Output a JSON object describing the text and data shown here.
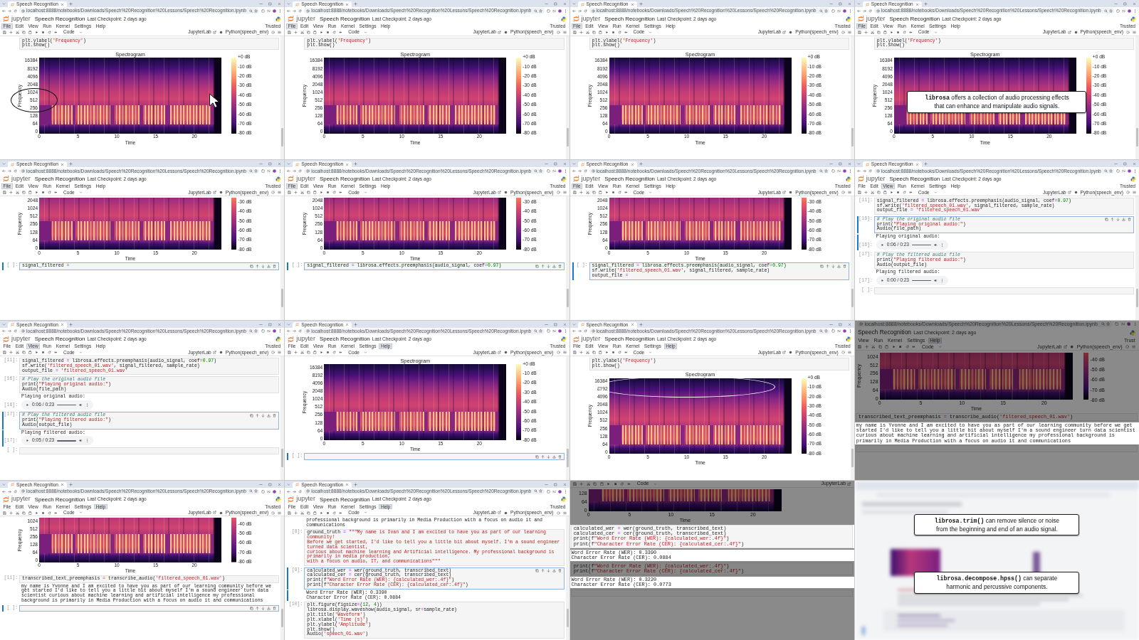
{
  "tiles": [
    {
      "kind": "notebook",
      "tab": "Speech Recognition",
      "url": "localhost:8888/notebooks/Downloads/Speech%20Recognition%20Lessons/Speech%20Recognition.ipynb",
      "logo": "jupyter",
      "title": "Speech Recognition",
      "checkpoint": "Last Checkpoint: 2 days ago",
      "menu": [
        {
          "label": "File",
          "selected": true
        },
        {
          "label": "Edit",
          "selected": false
        },
        {
          "label": "View",
          "selected": false
        },
        {
          "label": "Run",
          "selected": false
        },
        {
          "label": "Kernel",
          "selected": false
        },
        {
          "label": "Settings",
          "selected": false
        },
        {
          "label": "Help",
          "selected": false
        }
      ],
      "trusted": "Trusted",
      "cell_type": "Code",
      "lab_link": "JupyterLab",
      "kernel": "Python(speech_env)",
      "blocks": [
        {
          "kind": "code",
          "selected": false,
          "lines": [
            "plt.ylabel('Frequency')",
            "plt.show()"
          ]
        },
        {
          "kind": "spectrogram",
          "title": "Spectrogram",
          "y_label": "Frequency",
          "y_ticks": [
            "16384",
            "8192",
            "4096",
            "2048",
            "1024",
            "512",
            "256",
            "128",
            "64",
            "0"
          ],
          "x_ticks": [
            "0",
            "5",
            "10",
            "15",
            "20"
          ],
          "x_label": "Time",
          "colorbar_ticks": [
            "+0 dB",
            "-10 dB",
            "-20 dB",
            "-30 dB",
            "-40 dB",
            "-50 dB",
            "-60 dB",
            "-70 dB",
            "-80 dB"
          ],
          "axis_circled": true,
          "pointer": true
        }
      ]
    },
    {
      "kind": "notebook",
      "tab": "Speech Recognition",
      "url": "localhost:8888/notebooks/Downloads/Speech%20Recognition%20Lessons/Speech%20Recognition.ipynb",
      "logo": "jupyter",
      "title": "Speech Recognition",
      "checkpoint": "Last Checkpoint: 2 days ago",
      "menu": [
        {
          "label": "File",
          "selected": true
        },
        {
          "label": "Edit",
          "selected": false
        },
        {
          "label": "View",
          "selected": false
        },
        {
          "label": "Run",
          "selected": false
        },
        {
          "label": "Kernel",
          "selected": false
        },
        {
          "label": "Settings",
          "selected": false
        },
        {
          "label": "Help",
          "selected": false
        }
      ],
      "trusted": "Trusted",
      "cell_type": "Code",
      "lab_link": "JupyterLab",
      "kernel": "Python(speech_env)",
      "blocks": [
        {
          "kind": "code",
          "selected": false,
          "lines": [
            "plt.ylabel('Frequency')",
            "plt.show()"
          ]
        },
        {
          "kind": "spectrogram",
          "title": "Spectrogram",
          "y_label": "Frequency",
          "y_ticks": [
            "16384",
            "8192",
            "4096",
            "2048",
            "1024",
            "512",
            "256",
            "128",
            "64",
            "0"
          ],
          "x_ticks": [
            "0",
            "5",
            "10",
            "15",
            "20"
          ],
          "x_label": "Time",
          "colorbar_ticks": [
            "+0 dB",
            "-10 dB",
            "-20 dB",
            "-30 dB",
            "-40 dB",
            "-50 dB",
            "-60 dB",
            "-70 dB",
            "-80 dB"
          ]
        }
      ]
    },
    {
      "kind": "notebook",
      "tab": "Speech Recognition",
      "url": "localhost:8888/notebooks/Downloads/Speech%20Recognition%20Lessons/Speech%20Recognition.ipynb",
      "logo": "jupyter",
      "title": "Speech Recognition",
      "checkpoint": "Last Checkpoint: 2 days ago",
      "menu": [
        {
          "label": "File",
          "selected": true
        },
        {
          "label": "Edit",
          "selected": false
        },
        {
          "label": "View",
          "selected": false
        },
        {
          "label": "Run",
          "selected": false
        },
        {
          "label": "Kernel",
          "selected": false
        },
        {
          "label": "Settings",
          "selected": false
        },
        {
          "label": "Help",
          "selected": false
        }
      ],
      "trusted": "Trusted",
      "cell_type": "Code",
      "lab_link": "JupyterLab",
      "kernel": "Python(speech_env)",
      "blocks": [
        {
          "kind": "code",
          "selected": false,
          "lines": [
            "plt.ylabel('Frequency')",
            "plt.show()"
          ]
        },
        {
          "kind": "spectrogram",
          "title": "Spectrogram",
          "y_label": "Frequency",
          "y_ticks": [
            "16384",
            "8192",
            "4096",
            "2048",
            "1024",
            "512",
            "256",
            "128",
            "64",
            "0"
          ],
          "x_ticks": [
            "0",
            "5",
            "10",
            "15",
            "20"
          ],
          "x_label": "Time",
          "colorbar_ticks": [
            "+0 dB",
            "-10 dB",
            "-20 dB",
            "-30 dB",
            "-40 dB",
            "-50 dB",
            "-60 dB",
            "-70 dB",
            "-80 dB"
          ]
        }
      ]
    },
    {
      "kind": "notebook",
      "tab": "Speech Recognition",
      "url": "localhost:8888/notebooks/Downloads/Speech%20Recognition%20Lessons/Speech%20Recognition.ipynb",
      "logo": "jupyter",
      "title": "Speech Recognition",
      "checkpoint": "Last Checkpoint: 2 days ago",
      "menu": [
        {
          "label": "File",
          "selected": true
        },
        {
          "label": "Edit",
          "selected": false
        },
        {
          "label": "View",
          "selected": false
        },
        {
          "label": "Run",
          "selected": false
        },
        {
          "label": "Kernel",
          "selected": false
        },
        {
          "label": "Settings",
          "selected": false
        },
        {
          "label": "Help",
          "selected": false
        }
      ],
      "trusted": "Trusted",
      "cell_type": "Code",
      "lab_link": "JupyterLab",
      "kernel": "Python(speech_env)",
      "blocks": [
        {
          "kind": "code",
          "selected": false,
          "lines": [
            "plt.ylabel('Frequency')",
            "plt.show()"
          ]
        },
        {
          "kind": "spectrogram",
          "title": "Spectrogram",
          "y_label": "Frequency",
          "y_ticks": [
            "16384",
            "8192",
            "4096",
            "2048",
            "1024",
            "512",
            "256",
            "128",
            "64",
            "0"
          ],
          "x_ticks": [
            "0",
            "5",
            "10",
            "15",
            "20"
          ],
          "x_label": "Time",
          "colorbar_ticks": [
            "+0 dB",
            "-10 dB",
            "-20 dB",
            "-30 dB",
            "-40 dB",
            "-50 dB",
            "-60 dB",
            "-70 dB",
            "-80 dB"
          ]
        }
      ],
      "callouts": [
        "**librosa** offers a collection of audio processing effects that can enhance and manipulate audio signals."
      ]
    },
    {
      "kind": "notebook",
      "tab": "Speech Recognition",
      "url": "localhost:8888/notebooks/Downloads/Speech%20Recognition%20Lessons/Speech%20Recognition.ipynb",
      "logo": "jupyter",
      "title": "Speech Recognition",
      "checkpoint": "Last Checkpoint: 2 days ago",
      "menu": [
        {
          "label": "File",
          "selected": true
        },
        {
          "label": "Edit",
          "selected": false
        },
        {
          "label": "View",
          "selected": false
        },
        {
          "label": "Run",
          "selected": false
        },
        {
          "label": "Kernel",
          "selected": false
        },
        {
          "label": "Settings",
          "selected": false
        },
        {
          "label": "Help",
          "selected": false
        }
      ],
      "trusted": "Trusted",
      "cell_type": "Code",
      "lab_link": "JupyterLab",
      "kernel": "Python(speech_env)",
      "blocks": [
        {
          "kind": "spectrogram",
          "y_label": "Frequency",
          "y_ticks": [
            "2048",
            "1024",
            "512",
            "256",
            "128",
            "64",
            "0"
          ],
          "x_ticks": [
            "0",
            "5",
            "10",
            "15",
            "20"
          ],
          "x_label": "Time",
          "colorbar_ticks": [
            "-30 dB",
            "-40 dB",
            "-50 dB",
            "-60 dB",
            "-70 dB",
            "-80 dB"
          ]
        },
        {
          "kind": "code",
          "prompt": "[ ]:",
          "selected": true,
          "lines": [
            "signal_filtered = "
          ]
        }
      ]
    },
    {
      "kind": "notebook",
      "tab": "Speech Recognition",
      "url": "localhost:8888/notebooks/Downloads/Speech%20Recognition%20Lessons/Speech%20Recognition.ipynb",
      "logo": "jupyter",
      "title": "Speech Recognition",
      "checkpoint": "Last Checkpoint: 2 days ago",
      "menu": [
        {
          "label": "File",
          "selected": true
        },
        {
          "label": "Edit",
          "selected": false
        },
        {
          "label": "View",
          "selected": false
        },
        {
          "label": "Run",
          "selected": false
        },
        {
          "label": "Kernel",
          "selected": false
        },
        {
          "label": "Settings",
          "selected": false
        },
        {
          "label": "Help",
          "selected": false
        }
      ],
      "trusted": "Trusted",
      "cell_type": "Code",
      "lab_link": "JupyterLab",
      "kernel": "Python(speech_env)",
      "blocks": [
        {
          "kind": "spectrogram",
          "y_label": "Frequency",
          "y_ticks": [
            "2048",
            "1024",
            "512",
            "256",
            "128",
            "64",
            "0"
          ],
          "x_ticks": [
            "0",
            "5",
            "10",
            "15",
            "20"
          ],
          "x_label": "Time",
          "colorbar_ticks": [
            "-30 dB",
            "-40 dB",
            "-50 dB",
            "-60 dB",
            "-70 dB",
            "-80 dB"
          ]
        },
        {
          "kind": "code",
          "prompt": "[ ]:",
          "selected": true,
          "lines": [
            "signal_filtered = librosa.effects.preemphasis(audio_signal, coef=0.97)"
          ]
        }
      ]
    },
    {
      "kind": "notebook",
      "tab": "Speech Recognition",
      "url": "localhost:8888/notebooks/Downloads/Speech%20Recognition%20Lessons/Speech%20Recognition.ipynb",
      "logo": "jupyter",
      "title": "Speech Recognition",
      "checkpoint": "Last Checkpoint: 2 days ago",
      "menu": [
        {
          "label": "File",
          "selected": true
        },
        {
          "label": "Edit",
          "selected": false
        },
        {
          "label": "View",
          "selected": false
        },
        {
          "label": "Run",
          "selected": false
        },
        {
          "label": "Kernel",
          "selected": false
        },
        {
          "label": "Settings",
          "selected": false
        },
        {
          "label": "Help",
          "selected": false
        }
      ],
      "trusted": "Trusted",
      "cell_type": "Code",
      "lab_link": "JupyterLab",
      "kernel": "Python(speech_env)",
      "blocks": [
        {
          "kind": "spectrogram",
          "y_label": "Frequency",
          "y_ticks": [
            "2048",
            "1024",
            "512",
            "256",
            "128",
            "64",
            "0"
          ],
          "x_ticks": [
            "0",
            "5",
            "10",
            "15",
            "20"
          ],
          "x_label": "Time",
          "colorbar_ticks": [
            "-30 dB",
            "-40 dB",
            "-50 dB",
            "-60 dB",
            "-70 dB",
            "-80 dB"
          ]
        },
        {
          "kind": "code",
          "prompt": "[ ]:",
          "selected": true,
          "lines": [
            "signal_filtered = librosa.effects.preemphasis(audio_signal, coef=0.97)",
            "sf.write('filtered_speech_01.wav', signal_filtered, sample_rate)",
            "output_file = "
          ]
        }
      ]
    },
    {
      "kind": "notebook",
      "tab": "Speech Recognition",
      "url": "localhost:8888/notebooks/Downloads/Speech%20Recognition%20Lessons/Speech%20Recognition.ipynb",
      "logo": "jupyter",
      "title": "Speech Recognition",
      "checkpoint": "Last Checkpoint: 2 days ago",
      "menu": [
        {
          "label": "File",
          "selected": false
        },
        {
          "label": "Edit",
          "selected": false
        },
        {
          "label": "View",
          "selected": true
        },
        {
          "label": "Run",
          "selected": false
        },
        {
          "label": "Kernel",
          "selected": false
        },
        {
          "label": "Settings",
          "selected": false
        },
        {
          "label": "Help",
          "selected": false
        }
      ],
      "trusted": "Trusted",
      "cell_type": "Code",
      "lab_link": "JupyterLab",
      "kernel": "Python(speech_env)",
      "blocks": [
        {
          "kind": "code",
          "prompt": "[11]:",
          "selected": false,
          "lines": [
            "signal_filtered = librosa.effects.preemphasis(audio_signal, coef=0.97)",
            "sf.write('filtered_speech_01.wav', signal_filtered, sample_rate)",
            "output_file = 'filtered_speech_01.wav'"
          ]
        },
        {
          "kind": "code",
          "prompt": "[16]:",
          "selected": true,
          "lines": [
            "# Play the original audio file",
            "print(\"Playing original audio:\")",
            "Audio(file_path)"
          ]
        },
        {
          "kind": "audio",
          "prompt": "[16]:",
          "selected": true,
          "label": "Playing original audio:",
          "time": "0:06 / 0:23"
        },
        {
          "kind": "code",
          "prompt": "[17]:",
          "selected": false,
          "lines": [
            "# Play the filtered audio file",
            "print(\"Playing filtered audio:\")",
            "Audio(output_file)"
          ]
        },
        {
          "kind": "audio",
          "prompt": "[17]:",
          "selected": false,
          "label": "Playing filtered audio:",
          "time": "0:00 / 0:23"
        },
        {
          "kind": "code",
          "prompt": "[ ]:",
          "selected": false
        }
      ]
    },
    {
      "kind": "notebook",
      "tab": "Speech Recognition",
      "url": "localhost:8888/notebooks/Downloads/Speech%20Recognition%20Lessons/Speech%20Recognition.ipynb",
      "logo": "jupyter",
      "title": "Speech Recognition",
      "checkpoint": "Last Checkpoint: 2 days ago",
      "menu": [
        {
          "label": "File",
          "selected": false
        },
        {
          "label": "Edit",
          "selected": false
        },
        {
          "label": "View",
          "selected": true
        },
        {
          "label": "Run",
          "selected": false
        },
        {
          "label": "Kernel",
          "selected": false
        },
        {
          "label": "Settings",
          "selected": false
        },
        {
          "label": "Help",
          "selected": false
        }
      ],
      "trusted": "Trusted",
      "cell_type": "Code",
      "lab_link": "JupyterLab",
      "kernel": "Python(speech_env)",
      "blocks": [
        {
          "kind": "code",
          "prompt": "[11]:",
          "selected": false,
          "lines": [
            "signal_filtered = librosa.effects.preemphasis(audio_signal, coef=0.97)",
            "sf.write('filtered_speech_01.wav', signal_filtered, sample_rate)",
            "output_file = 'filtered_speech_01.wav'"
          ]
        },
        {
          "kind": "code",
          "prompt": "[16]:",
          "selected": false,
          "lines": [
            "# Play the original audio file",
            "print(\"Playing original audio:\")",
            "Audio(file_path)"
          ]
        },
        {
          "kind": "audio",
          "prompt": "[16]:",
          "selected": false,
          "label": "Playing original audio:",
          "time": "0:06 / 0:23"
        },
        {
          "kind": "code",
          "prompt": "[17]:",
          "selected": true,
          "lines": [
            "# Play the filtered audio file",
            "print(\"Playing filtered audio:\")",
            "Audio(output_file)"
          ]
        },
        {
          "kind": "audio",
          "prompt": "[17]:",
          "selected": true,
          "label": "Playing filtered audio:",
          "time": "0:05 / 0:23"
        },
        {
          "kind": "code",
          "prompt": "[ ]:",
          "selected": false
        }
      ]
    },
    {
      "kind": "notebook",
      "tab": "Speech Recognition",
      "url": "localhost:8888/notebooks/Downloads/Speech%20Recognition%20Lessons/Speech%20Recognition.ipynb",
      "logo": "jupyter",
      "title": "Speech Recognition",
      "checkpoint": "Last Checkpoint: 2 days ago",
      "menu": [
        {
          "label": "File",
          "selected": false
        },
        {
          "label": "Edit",
          "selected": false
        },
        {
          "label": "View",
          "selected": false
        },
        {
          "label": "Run",
          "selected": false
        },
        {
          "label": "Kernel",
          "selected": false
        },
        {
          "label": "Settings",
          "selected": false
        },
        {
          "label": "Help",
          "selected": true
        }
      ],
      "trusted": "Trusted",
      "cell_type": "Code",
      "lab_link": "JupyterLab",
      "kernel": "Python(speech_env)",
      "blocks": [
        {
          "kind": "spectrogram",
          "title": "Spectrogram",
          "y_label": "Frequency",
          "y_ticks": [
            "16384",
            "8192",
            "4096",
            "2048",
            "1024",
            "512",
            "256",
            "128",
            "64",
            "0"
          ],
          "x_ticks": [
            "0",
            "5",
            "10",
            "15",
            "20"
          ],
          "x_label": "Time",
          "colorbar_ticks": [
            "+0 dB",
            "-10 dB",
            "-20 dB",
            "-30 dB",
            "-40 dB",
            "-50 dB",
            "-60 dB",
            "-70 dB",
            "-80 dB"
          ]
        },
        {
          "kind": "code",
          "prompt": "[ ]:",
          "selected": true
        }
      ]
    },
    {
      "kind": "notebook",
      "tab": "Speech Recognition",
      "url": "localhost:8888/notebooks/Downloads/Speech%20Recognition%20Lessons/Speech%20Recognition.ipynb",
      "logo": "jupyter",
      "title": "Speech Recognition",
      "checkpoint": "Last Checkpoint: 2 days ago",
      "menu": [
        {
          "label": "File",
          "selected": false
        },
        {
          "label": "Edit",
          "selected": false
        },
        {
          "label": "View",
          "selected": false
        },
        {
          "label": "Run",
          "selected": false
        },
        {
          "label": "Kernel",
          "selected": false
        },
        {
          "label": "Settings",
          "selected": false
        },
        {
          "label": "Help",
          "selected": true
        }
      ],
      "trusted": "Trusted",
      "cell_type": "Code",
      "lab_link": "JupyterLab",
      "kernel": "Python(speech_env)",
      "blocks": [
        {
          "kind": "code",
          "selected": false,
          "lines": [
            "plt.ylabel('Frequency')",
            "plt.show()"
          ]
        },
        {
          "kind": "spectrogram",
          "title": "Spectrogram",
          "y_label": "Frequency",
          "y_ticks": [
            "16384",
            "8192",
            "4096",
            "2048",
            "1024",
            "512",
            "256",
            "128",
            "64",
            "0"
          ],
          "x_ticks": [
            "0",
            "5",
            "10",
            "15",
            "20"
          ],
          "x_label": "Time",
          "colorbar_ticks": [
            "+0 dB",
            "-10 dB",
            "-20 dB",
            "-30 dB",
            "-40 dB",
            "-50 dB",
            "-60 dB",
            "-70 dB",
            "-80 dB"
          ],
          "band_circled": true
        }
      ]
    },
    {
      "kind": "zoomed",
      "chrome_dimmed": true,
      "url": "localhost:8888/notebooks/Downloads/Speech%20Recognition%20Lessons/Speech%20Recognition.ipynb",
      "title": "Speech Recognition",
      "checkpoint": "Last Checkpoint: 2 days ago",
      "menu": [
        {
          "label": "View",
          "selected": false
        },
        {
          "label": "Run",
          "selected": false
        },
        {
          "label": "Kernel",
          "selected": false
        },
        {
          "label": "Settings",
          "selected": false
        },
        {
          "label": "Help",
          "selected": true
        }
      ],
      "trusted": "Trust",
      "cell_type": "Code",
      "lab_link": "JupyterLab",
      "kernel": "Python(speech_env)",
      "blocks": [
        {
          "kind": "spectrogram",
          "dimmed": true,
          "y_label": "Frequency",
          "y_ticks": [
            "1024",
            "512",
            "256",
            "128",
            "64",
            "0"
          ],
          "x_ticks": [
            "0",
            "5",
            "10",
            "15",
            "20"
          ],
          "x_label": "Time",
          "colorbar_ticks": [
            "-40 dB",
            "-50 dB",
            "-60 dB",
            "-70 dB",
            "-80 dB"
          ]
        },
        {
          "kind": "code",
          "selected": false,
          "dimmed": true,
          "lines": [
            "transcribed_text_preemphasis = transcribe_audio('filtered_speech_01.wav')"
          ]
        },
        {
          "kind": "output",
          "selected": false,
          "dimmed": false,
          "lines": [
            "my name is Yvonne and I am excited to have you as part of our learning community before we get started I'd like to tell you a little bit about myself I'm a sound engineer turn data scientist curious about machine learning and artificial intelligence my professional background is primarily in Media Production with a focus on audio it and communications"
          ]
        },
        {
          "kind": "code",
          "selected": false,
          "dimmed": true
        }
      ]
    },
    {
      "kind": "notebook",
      "tab": "Speech Recognition",
      "url": "localhost:8888/notebooks/Downloads/Speech%20Recognition%20Lessons/Speech%20Recognition.ipynb",
      "logo": "jupyter",
      "title": "Speech Recognition",
      "checkpoint": "Last Checkpoint: 2 days ago",
      "menu": [
        {
          "label": "File",
          "selected": false
        },
        {
          "label": "Edit",
          "selected": false
        },
        {
          "label": "View",
          "selected": false
        },
        {
          "label": "Run",
          "selected": false
        },
        {
          "label": "Kernel",
          "selected": false
        },
        {
          "label": "Settings",
          "selected": false
        },
        {
          "label": "Help",
          "selected": true
        }
      ],
      "trusted": "Trusted",
      "cell_type": "Code",
      "lab_link": "JupyterLab",
      "kernel": "Python(speech_env)",
      "blocks": [
        {
          "kind": "spectrogram",
          "y_label": "Frequency",
          "y_ticks": [
            "1024",
            "512",
            "256",
            "128",
            "64",
            "0"
          ],
          "x_ticks": [
            "0",
            "5",
            "10",
            "15",
            "20"
          ],
          "x_label": "Time",
          "colorbar_ticks": [
            "-40 dB",
            "-50 dB",
            "-60 dB",
            "-70 dB",
            "-80 dB"
          ]
        },
        {
          "kind": "code",
          "prompt": "[11]:",
          "selected": false,
          "lines": [
            "transcribed_text_preemphasis = transcribe_audio('filtered_speech_01.wav')"
          ]
        },
        {
          "kind": "output",
          "selected": false,
          "lines": [
            "my name is Yvonne and I am excited to have you as part of our learning community before we get started I'd like to tell you a little bit about myself I'm a sound engineer turn data scientist curious about machine learning and artificial intelligence my professional background is primarily in Media Production with a focus on audio it and communications"
          ]
        },
        {
          "kind": "code",
          "prompt": "[ ]:",
          "selected": true
        }
      ]
    },
    {
      "kind": "notebook",
      "tab": "Speech Recognition",
      "url": "localhost:8888/notebooks/Downloads/Speech%20Recognition%20Lessons/Speech%20Recognition.ipynb",
      "logo": "jupyter",
      "title": "Speech Recognition",
      "checkpoint": "Last Checkpoint: 2 days ago",
      "menu": [
        {
          "label": "File",
          "selected": false
        },
        {
          "label": "Edit",
          "selected": false
        },
        {
          "label": "View",
          "selected": false
        },
        {
          "label": "Run",
          "selected": false
        },
        {
          "label": "Kernel",
          "selected": false
        },
        {
          "label": "Settings",
          "selected": false
        },
        {
          "label": "Help",
          "selected": true
        }
      ],
      "trusted": "Trusted",
      "cell_type": "Code",
      "lab_link": "JupyterLab",
      "kernel": "Python(speech_env)",
      "blocks": [
        {
          "kind": "output",
          "selected": false,
          "lines": [
            "professional background is primarily in Media Production with a focus on audio it and communications"
          ]
        },
        {
          "kind": "code",
          "prompt": "[8]:",
          "selected": false,
          "lines": [
            "ground_truth = \"\"\"My name is Ivan and I am excited to have you as part of our learning community!",
            "Before we get started, I'd like to tell you a little bit about myself. I'm a sound engineer turned data scientist,",
            "curious about machine learning and Artificial intelligence. My professional background is primarily in media production,",
            "with a focus on audio, IT, and communications\"\"\""
          ]
        },
        {
          "kind": "code",
          "prompt": "[9]:",
          "selected": true,
          "lines": [
            "calculated_wer = wer(ground_truth, transcribed_text)",
            "calculated_cer = cer(ground_truth, transcribed_text)",
            "print(f\"Word Error Rate (WER): {calculated_wer:.4f}\")",
            "print(f\"Character Error Rate (CER): {calculated_cer:.4f}\")"
          ]
        },
        {
          "kind": "output",
          "selected": true,
          "lines": [
            "Word Error Rate (WER): 0.3390",
            "Character Error Rate (CER): 0.0884"
          ]
        },
        {
          "kind": "code",
          "prompt": "[10]:",
          "selected": false,
          "lines": [
            "plt.figure(figsize=(12, 4))",
            "librosa.display.waveshow(audio_signal, sr=sample_rate)",
            "plt.title('Waveform')",
            "plt.xlabel('Time (s)')",
            "plt.ylabel('Amplitude')",
            "plt.show()",
            "Audio('speech_01.wav')"
          ]
        }
      ]
    },
    {
      "kind": "zoomed",
      "chrome_dimmed": true,
      "cell_type": "Code",
      "lab_link": "JupyterLab",
      "blocks": [
        {
          "kind": "spectrogram",
          "dimmed": true,
          "y_ticks": [
            "128",
            "64",
            "0"
          ],
          "x_ticks": [
            "0",
            "5",
            "10",
            "15",
            "20"
          ],
          "x_label": "Time"
        },
        {
          "kind": "code",
          "selected": false,
          "dimmed": false,
          "lines": [
            "calculated_wer = wer(ground_truth, transcribed_text)",
            "calculated_cer = cer(ground_truth, transcribed_text)",
            "print(f\"Word Error Rate (WER): {calculated_wer:.4f}\")",
            "print(f\"Character Error Rate (CER): {calculated_cer:.4f}\")"
          ]
        },
        {
          "kind": "output",
          "selected": false,
          "dimmed": false,
          "lines": [
            "Word Error Rate (WER): 0.3390",
            "Character Error Rate (CER): 0.0884"
          ]
        },
        {
          "kind": "code",
          "selected": false,
          "dimmed": true,
          "lines": [
            "print(f\"Word Error Rate (WER): {calculated_wer:.4f}\")",
            "print(f\"Character Error Rate (CER): {calculated_cer:.4f}\")"
          ]
        },
        {
          "kind": "output",
          "selected": false,
          "dimmed": false,
          "lines": [
            "Word Error Rate (WER): 0.3220",
            "Character Error Rate (CER): 0.0773"
          ]
        },
        {
          "kind": "code",
          "selected": false,
          "dimmed": true
        }
      ]
    },
    {
      "kind": "blurred",
      "callouts": [
        "**librosa.trim()** can remove silence or noise from the beginning and end of an audio signal.",
        "**librosa.decompose.hpss()** can separate harmonic and percussive components."
      ]
    }
  ]
}
